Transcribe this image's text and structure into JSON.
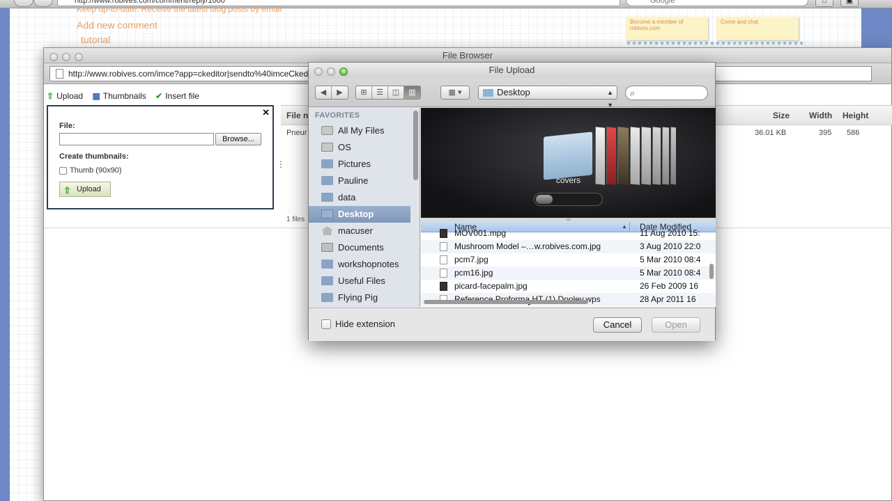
{
  "bg_browser": {
    "url": "http://www.robives.com/comment/reply/1000",
    "search_placeholder": "Google",
    "link_text_1": "Keep up-to-date: Receive the latest blog posts by email",
    "link_add_comment": "Add new comment",
    "link_tutorial": "tutorial",
    "sticky_1": "Become a member of robives.com",
    "sticky_2": "Come and chat"
  },
  "file_browser": {
    "title": "File Browser",
    "url": "http://www.robives.com/imce?app=ckeditor|sendto%40imceCkeditSendTo|params%40CKEditorFuncNum%3D1",
    "tools": [
      {
        "label": "Upload"
      },
      {
        "label": "Thumbnails"
      },
      {
        "label": "Insert file"
      }
    ],
    "upload_panel": {
      "file_label": "File:",
      "browse_label": "Browse...",
      "thumbs_label": "Create thumbnails:",
      "thumb_option": "Thumb (90x90)",
      "upload_button": "Upload"
    },
    "list": {
      "columns": {
        "name": "File n",
        "size": "Size",
        "width": "Width",
        "height": "Height"
      },
      "row": {
        "name": "Pneur",
        "size": "36.01 KB",
        "width": "395",
        "height": "586"
      },
      "footer": "1 files"
    }
  },
  "dialog": {
    "title": "File Upload",
    "location": "Desktop",
    "sidebar": {
      "heading": "FAVORITES",
      "items": [
        {
          "label": "All My Files",
          "icon": "all-files-icon"
        },
        {
          "label": "OS",
          "icon": "drive-icon"
        },
        {
          "label": "Pictures",
          "icon": "folder-icon"
        },
        {
          "label": "Pauline",
          "icon": "folder-icon"
        },
        {
          "label": "data",
          "icon": "folder-icon"
        },
        {
          "label": "Desktop",
          "icon": "desktop-icon",
          "selected": true
        },
        {
          "label": "macuser",
          "icon": "home-icon"
        },
        {
          "label": "Documents",
          "icon": "documents-icon"
        },
        {
          "label": "workshopnotes",
          "icon": "folder-icon"
        },
        {
          "label": "Useful Files",
          "icon": "folder-icon"
        },
        {
          "label": "Flying Pig",
          "icon": "folder-icon"
        }
      ]
    },
    "preview_caption": "covers",
    "files": {
      "col_name": "Name",
      "col_date": "Date Modified",
      "rows": [
        {
          "name": "MOV001.mpg",
          "date": "11 Aug 2010 15:",
          "icon": "movie-icon"
        },
        {
          "name": "Mushroom Model –…w.robives.com.jpg",
          "date": "3 Aug 2010 22:0",
          "icon": "image-icon"
        },
        {
          "name": "pcm7.jpg",
          "date": "5 Mar 2010 08:4",
          "icon": "image-icon"
        },
        {
          "name": "pcm16.jpg",
          "date": "5 Mar 2010 08:4",
          "icon": "image-icon"
        },
        {
          "name": "picard-facepalm.jpg",
          "date": "26 Feb 2009 16",
          "icon": "image-icon"
        },
        {
          "name": "Reference Proforma HT (1) Dooley.wps",
          "date": "28 Apr 2011 16",
          "icon": "document-icon"
        }
      ]
    },
    "hide_extension": "Hide extension",
    "cancel": "Cancel",
    "open": "Open"
  }
}
